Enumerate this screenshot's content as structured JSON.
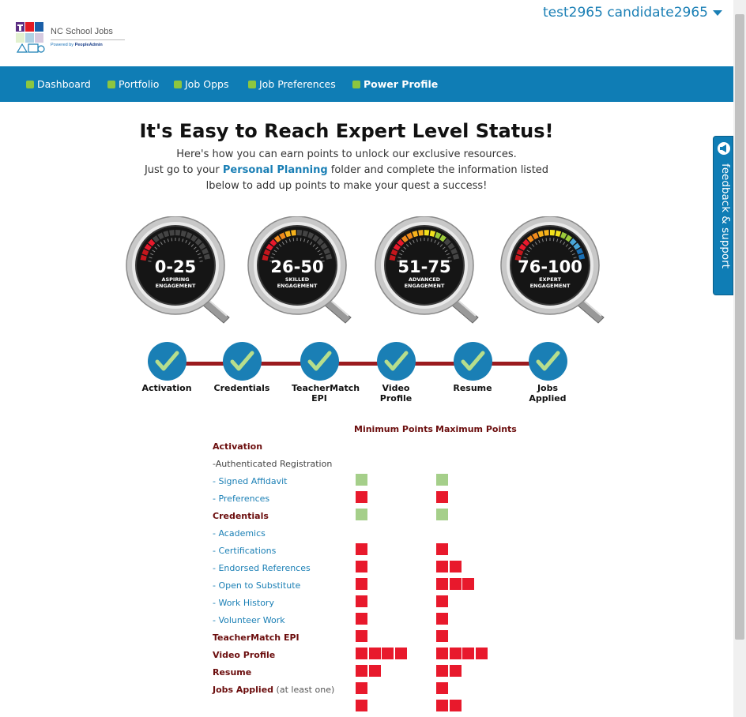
{
  "header": {
    "logo_name": "NC School Jobs",
    "logo_powered_prefix": "Powered by",
    "logo_powered_brand": "PeopleAdmin",
    "user_name": "test2965 candidate2965"
  },
  "nav": {
    "items": [
      {
        "label": "Dashboard",
        "bold": false
      },
      {
        "label": "Portfolio",
        "bold": false
      },
      {
        "label": "Job Opps",
        "bold": false
      },
      {
        "label": "Job Preferences",
        "bold": false
      },
      {
        "label": "Power Profile",
        "bold": true
      }
    ]
  },
  "feedback": {
    "label": "feedback & support"
  },
  "main": {
    "headline": "It's Easy to Reach Expert Level Status!",
    "intro_line1": "Here's how you can earn points to unlock our exclusive resources.",
    "intro_line2_before": "Just go to your ",
    "intro_link": "Personal Planning",
    "intro_line2_after": " folder and complete the information listed",
    "intro_line3": "lbelow to add up points to make your quest a success!"
  },
  "gauges": [
    {
      "range": "0-25",
      "level_line1": "ASPIRING",
      "level_line2": "ENGAGEMENT",
      "lit_segments": 2
    },
    {
      "range": "26-50",
      "level_line1": "SKILLED",
      "level_line2": "ENGAGEMENT",
      "lit_segments": 4
    },
    {
      "range": "51-75",
      "level_line1": "ADVANCED",
      "level_line2": "ENGAGEMENT",
      "lit_segments": 6
    },
    {
      "range": "76-100",
      "level_line1": "EXPERT",
      "level_line2": "ENGAGEMENT",
      "lit_segments": 8
    }
  ],
  "steps": [
    {
      "label": "Activation",
      "complete": true
    },
    {
      "label": "Credentials",
      "complete": true
    },
    {
      "label": "TeacherMatch EPI",
      "complete": true
    },
    {
      "label": "Video Profile",
      "complete": true
    },
    {
      "label": "Resume",
      "complete": true
    },
    {
      "label": "Jobs Applied",
      "complete": true
    }
  ],
  "points_table": {
    "min_header": "Minimum Points",
    "max_header": "Maximum Points",
    "rows": [
      {
        "label": "Activation",
        "kind": "head",
        "min": 0,
        "max": 0,
        "color": ""
      },
      {
        "label": "-Authenticated Registration",
        "kind": "plain",
        "min": 1,
        "max": 1,
        "color": "green"
      },
      {
        "label": "- Signed Affidavit",
        "kind": "item",
        "min": 1,
        "max": 1,
        "color": "red"
      },
      {
        "label": "- Preferences",
        "kind": "item",
        "min": 1,
        "max": 1,
        "color": "green"
      },
      {
        "label": "Credentials",
        "kind": "head",
        "min": 0,
        "max": 0,
        "color": ""
      },
      {
        "label": "- Academics",
        "kind": "item",
        "min": 1,
        "max": 1,
        "color": "red"
      },
      {
        "label": "- Certifications",
        "kind": "item",
        "min": 1,
        "max": 2,
        "color": "red"
      },
      {
        "label": "- Endorsed References",
        "kind": "item",
        "min": 1,
        "max": 3,
        "color": "red"
      },
      {
        "label": "- Open to Substitute",
        "kind": "item",
        "min": 1,
        "max": 1,
        "color": "red"
      },
      {
        "label": "- Work History",
        "kind": "item",
        "min": 1,
        "max": 1,
        "color": "red"
      },
      {
        "label": "- Volunteer Work",
        "kind": "item",
        "min": 1,
        "max": 1,
        "color": "red"
      },
      {
        "label": "TeacherMatch EPI",
        "kind": "head",
        "min": 4,
        "max": 4,
        "color": "red"
      },
      {
        "label": "Video Profile",
        "kind": "head",
        "min": 2,
        "max": 2,
        "color": "red"
      },
      {
        "label": "Resume",
        "kind": "head",
        "min": 1,
        "max": 1,
        "color": "red"
      },
      {
        "label": "Jobs Applied",
        "kind": "head",
        "note": "(at least one)",
        "min": 1,
        "max": 2,
        "color": "red"
      }
    ]
  },
  "colors": {
    "nav_bg": "#0f7db5",
    "accent_green": "#8dc63f",
    "link_blue": "#1a7fb5",
    "heading_maroon": "#6b0d0d",
    "box_red": "#e8192c",
    "box_green": "#a5cf8a"
  }
}
